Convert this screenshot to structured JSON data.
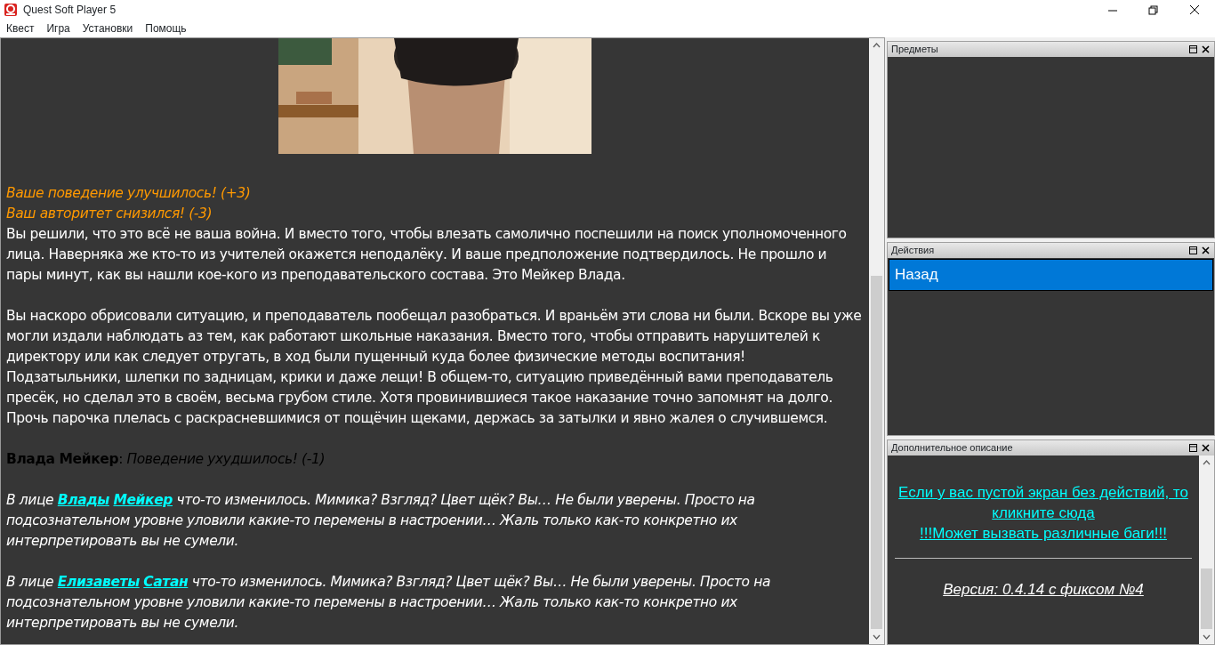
{
  "window": {
    "title": "Quest Soft Player 5"
  },
  "menu": [
    {
      "label": "Квест"
    },
    {
      "label": "Игра"
    },
    {
      "label": "Установки"
    },
    {
      "label": "Помощь"
    }
  ],
  "main": {
    "blocks": [
      {
        "kind": "notice",
        "text": "Ваше поведение улучшилось! (+3)"
      },
      {
        "kind": "notice",
        "text": "Ваш авторитет снизился! (-3)"
      },
      {
        "kind": "text",
        "text": "Вы решили, что это всё не ваша война. И вместо того, чтобы влезать самолично поспешили на поиск уполномоченного лица. Наверняка же кто-то из учителей окажется неподалёку. И ваше предположение подтвердилось. Не прошло и пары минут, как вы нашли кое-кого из преподавательского состава. Это Мейкер Влада."
      },
      {
        "kind": "gap"
      },
      {
        "kind": "text",
        "text": "Вы наскоро обрисовали ситуацию, и преподаватель пообещал разобраться. И враньём эти слова ни были. Вскоре вы уже могли издали наблюдать аз тем, как работают школьные наказания. Вместо того, чтобы отправить нарушителей к директору или как следует отругать, в ход были пущенный куда более физические методы воспитания! Подзатыльники, шлепки по задницам, крики и даже лещи! В общем-то, ситуацию приведённый вами преподаватель пресёк, но сделал это в своём, весьма грубом стиле. Хотя провинившиеся такое наказание точно запомнят на долго. Прочь парочка плелась с раскрасневшимися от пощёчин щеками, держась за затылки и явно жалея о случившемся."
      },
      {
        "kind": "gap"
      },
      {
        "kind": "speech",
        "speaker": "Влада Мейкер",
        "separator": ":",
        "text": "Поведение ухудшилось! (-1)"
      },
      {
        "kind": "gap"
      },
      {
        "kind": "change",
        "parts": [
          {
            "text": "В лице "
          },
          {
            "link": "Влады",
            "gap_after": true
          },
          {
            "link": "Мейкер"
          },
          {
            "text": " что-то изменилось. Мимика? Взгляд? Цвет щёк? Вы… Не были уверены. Просто на подсознательном уровне уловили какие-то перемены в настроении… Жаль только как-то конкретно их интерпретировать вы не сумели."
          }
        ]
      },
      {
        "kind": "gap"
      },
      {
        "kind": "change",
        "parts": [
          {
            "text": "В лице "
          },
          {
            "link": "Елизаветы",
            "gap_after": true
          },
          {
            "link": "Сатан"
          },
          {
            "text": " что-то изменилось. Мимика? Взгляд? Цвет щёк? Вы… Не были уверены. Просто на подсознательном уровне уловили какие-то перемены в настроении… Жаль только как-то конкретно их интерпретировать вы не сумели."
          }
        ]
      }
    ]
  },
  "panels": [
    {
      "kind": "items",
      "title": "Предметы"
    },
    {
      "kind": "actions",
      "title": "Действия",
      "actions": [
        {
          "label": "Назад",
          "selected": true
        }
      ]
    },
    {
      "kind": "extra",
      "title": "Дополнительное описание",
      "links": [
        {
          "text": "Если у вас пустой экран без действий, то кликните сюда"
        },
        {
          "text": "!!!Может вызвать различные баги!!!"
        }
      ],
      "version": "Версия: 0.4.14 с фиксом №4"
    }
  ]
}
